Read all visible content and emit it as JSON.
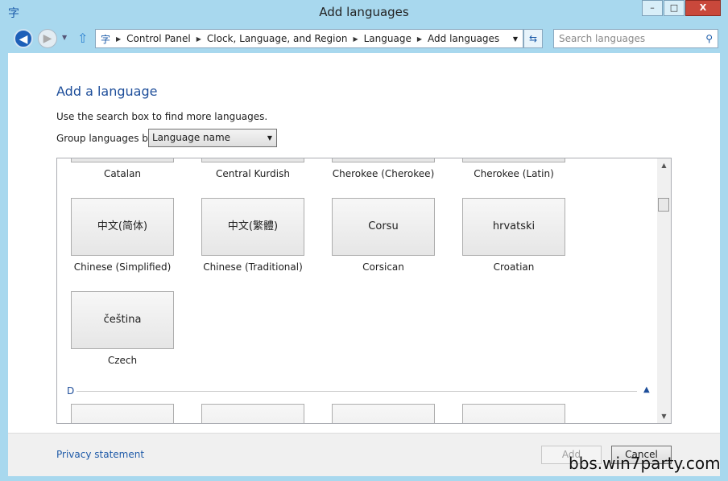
{
  "window": {
    "title": "Add languages",
    "minimize": "–",
    "maximize": "□",
    "close": "X"
  },
  "nav": {
    "breadcrumb": [
      "Control Panel",
      "Clock, Language, and Region",
      "Language",
      "Add languages"
    ],
    "search_placeholder": "Search languages"
  },
  "main": {
    "heading": "Add a language",
    "hint": "Use the search box to find more languages.",
    "group_label": "Group languages by:",
    "group_value": "Language name"
  },
  "languages": {
    "row1": [
      "Catalan",
      "Central Kurdish",
      "Cherokee (Cherokee)",
      "Cherokee (Latin)"
    ],
    "row2": [
      {
        "native": "中文(简体)",
        "name": "Chinese (Simplified)"
      },
      {
        "native": "中文(繁體)",
        "name": "Chinese (Traditional)"
      },
      {
        "native": "Corsu",
        "name": "Corsican"
      },
      {
        "native": "hrvatski",
        "name": "Croatian"
      }
    ],
    "row3": [
      {
        "native": "čeština",
        "name": "Czech"
      }
    ],
    "section_d": "D"
  },
  "footer": {
    "privacy": "Privacy statement",
    "add": "Add",
    "cancel": "Cancel"
  },
  "watermark": "bbs.win7party.com"
}
